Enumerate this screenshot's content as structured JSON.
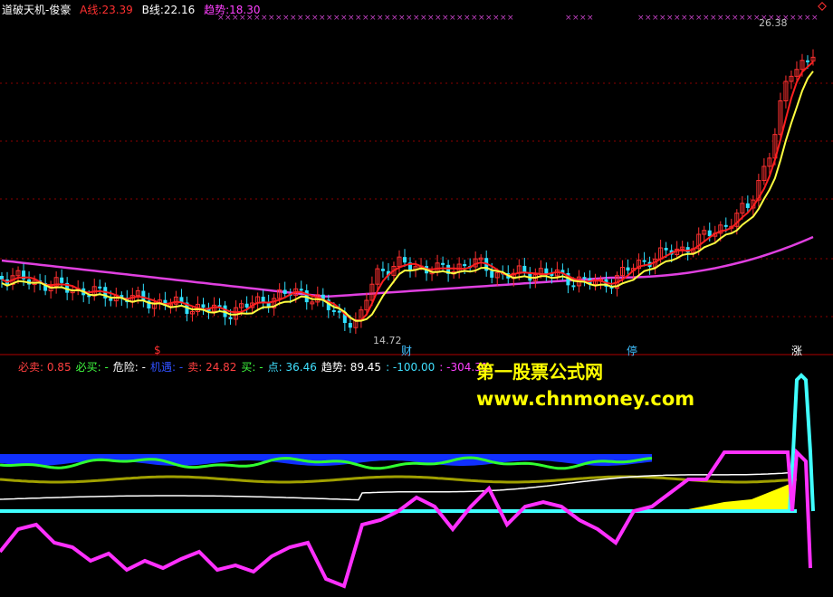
{
  "top_panel": {
    "title": "道破天机-俊豪",
    "a_label": "A线:",
    "a_value": "23.39",
    "b_label": "B线:",
    "b_value": "22.16",
    "trend_label": "趋势:",
    "trend_value": "18.30",
    "high_label": "26.38",
    "low_label": "14.72",
    "signals": [
      "$",
      "财",
      "停",
      "涨"
    ]
  },
  "bottom_panel": {
    "items": [
      {
        "label": "必卖:",
        "value": "0.85",
        "color": "#ff4040"
      },
      {
        "label": "必买:",
        "value": "-",
        "color": "#40ff40"
      },
      {
        "label": "危险:",
        "value": "-",
        "color": "#ffffff"
      },
      {
        "label": "机遇:",
        "value": "-",
        "color": "#3050ff"
      },
      {
        "label": "卖:",
        "value": "24.82",
        "color": "#ff4040"
      },
      {
        "label": "买:",
        "value": "-",
        "color": "#40ff40"
      },
      {
        "label": "点:",
        "value": "36.46",
        "color": "#40e0ff"
      },
      {
        "label": "趋势:",
        "value": "89.45",
        "color": "#ffffff"
      },
      {
        "label": ":",
        "value": "-100.00",
        "color": "#40e0ff"
      },
      {
        "label": ":",
        "value": "-304.31",
        "color": "#ff40ff"
      }
    ]
  },
  "watermark": {
    "line1": "第一股票公式网",
    "line2": "www.chnmoney.com"
  },
  "colors": {
    "background": "#000000",
    "up": "#ff3030",
    "down": "#30e0ff",
    "a_line": "#ff2020",
    "b_line": "#ffff40",
    "trend_line": "#e040e0",
    "grid": "#8b0000"
  },
  "chart_data": [
    {
      "type": "candlestick",
      "title": "道破天机-俊豪",
      "series": [
        {
          "name": "A线",
          "last": 23.39
        },
        {
          "name": "B线",
          "last": 22.16
        },
        {
          "name": "趋势",
          "last": 18.3
        }
      ],
      "high": 26.38,
      "low": 14.72,
      "ylim": [
        13.5,
        27.5
      ]
    },
    {
      "type": "line",
      "series": [
        {
          "name": "必卖",
          "last": 0.85
        },
        {
          "name": "卖",
          "last": 24.82
        },
        {
          "name": "点",
          "last": 36.46
        },
        {
          "name": "趋势",
          "last": 89.45
        }
      ],
      "values_shown": [
        -100.0,
        -304.31
      ]
    }
  ]
}
